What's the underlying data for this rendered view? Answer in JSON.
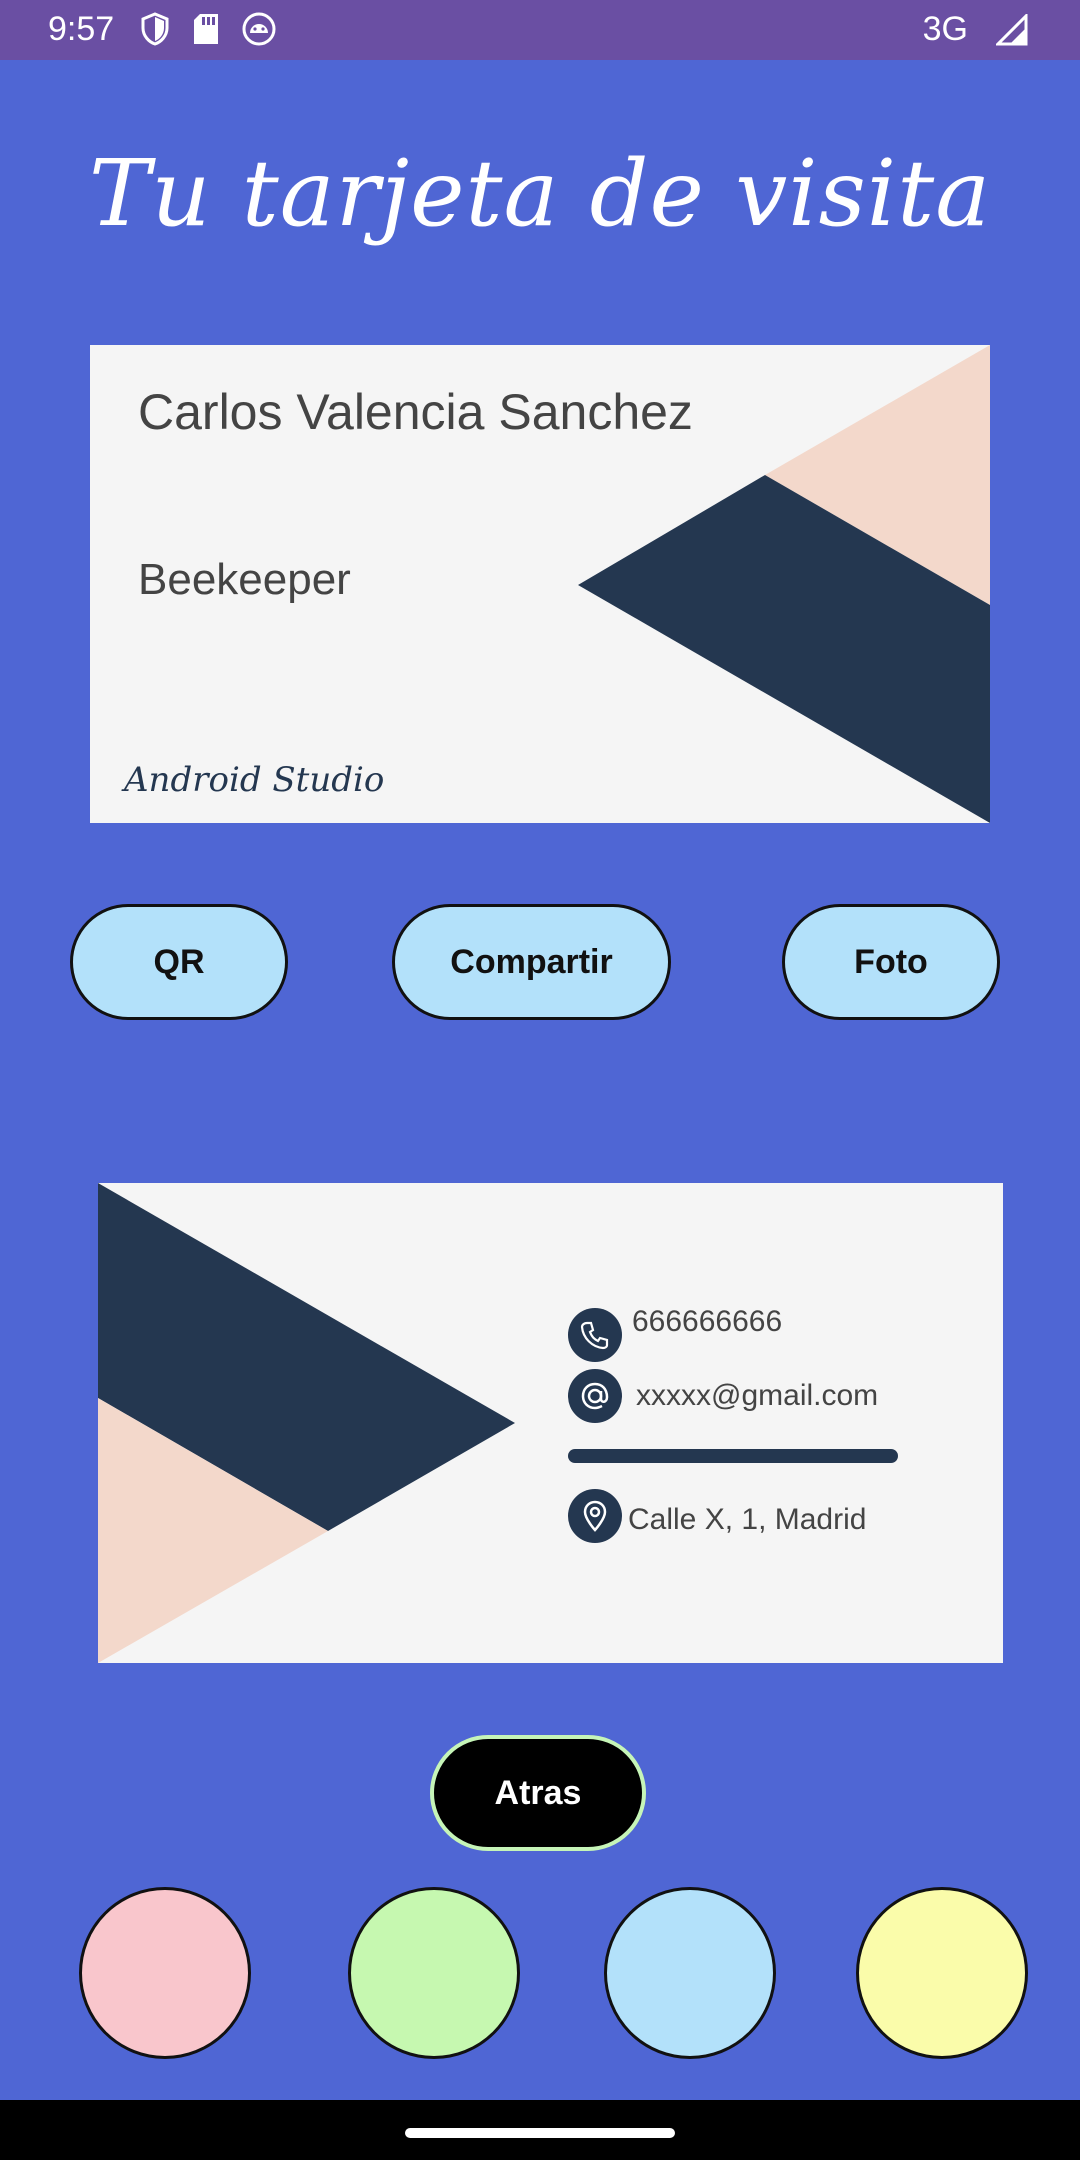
{
  "status_bar": {
    "time": "9:57",
    "network": "3G"
  },
  "title": "Tu tarjeta de visita",
  "card_front": {
    "name": "Carlos Valencia Sanchez",
    "job": "Beekeeper",
    "brand": "Android Studio"
  },
  "actions": {
    "qr": "QR",
    "share": "Compartir",
    "photo": "Foto"
  },
  "card_back": {
    "phone": "666666666",
    "email": "xxxxx@gmail.com",
    "address": "Calle X, 1, Madrid"
  },
  "back_button": "Atras",
  "colors": {
    "background": "#4f66d4",
    "status_bar": "#6a4fa3",
    "card_dark": "#243750",
    "card_peach": "#f3d8cb",
    "swatches": [
      "#f9c6cc",
      "#c6f8b0",
      "#b3e1fa",
      "#fafcaa"
    ]
  },
  "icons": [
    "shield-icon",
    "sd-card-icon",
    "android-face-icon",
    "signal-icon",
    "phone-icon",
    "at-icon",
    "location-pin-icon"
  ]
}
